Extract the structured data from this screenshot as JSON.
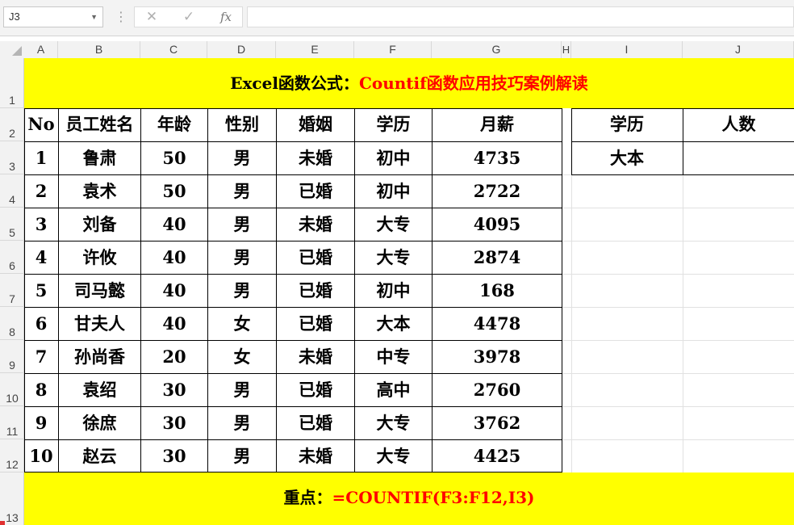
{
  "formula_bar": {
    "name_box": "J3",
    "cancel_icon": "✕",
    "enter_icon": "✓",
    "fx_label": "fx",
    "formula": ""
  },
  "columns": [
    "A",
    "B",
    "C",
    "D",
    "E",
    "F",
    "G",
    "H",
    "I",
    "J"
  ],
  "rows": [
    "1",
    "2",
    "3",
    "4",
    "5",
    "6",
    "7",
    "8",
    "9",
    "10",
    "11",
    "12",
    "13"
  ],
  "title": {
    "prefix": "Excel函数公式：",
    "highlight": "Countif函数应用技巧案例解读"
  },
  "table": {
    "headers": [
      "No",
      "员工姓名",
      "年龄",
      "性别",
      "婚姻",
      "学历",
      "月薪"
    ],
    "rows": [
      [
        "1",
        "鲁肃",
        "50",
        "男",
        "未婚",
        "初中",
        "4735"
      ],
      [
        "2",
        "袁术",
        "50",
        "男",
        "已婚",
        "初中",
        "2722"
      ],
      [
        "3",
        "刘备",
        "40",
        "男",
        "未婚",
        "大专",
        "4095"
      ],
      [
        "4",
        "许攸",
        "40",
        "男",
        "已婚",
        "大专",
        "2874"
      ],
      [
        "5",
        "司马懿",
        "40",
        "男",
        "已婚",
        "初中",
        "168"
      ],
      [
        "6",
        "甘夫人",
        "40",
        "女",
        "已婚",
        "大本",
        "4478"
      ],
      [
        "7",
        "孙尚香",
        "20",
        "女",
        "未婚",
        "中专",
        "3978"
      ],
      [
        "8",
        "袁绍",
        "30",
        "男",
        "已婚",
        "高中",
        "2760"
      ],
      [
        "9",
        "徐庶",
        "30",
        "男",
        "已婚",
        "大专",
        "3762"
      ],
      [
        "10",
        "赵云",
        "30",
        "男",
        "未婚",
        "大专",
        "4425"
      ]
    ]
  },
  "lookup": {
    "headers": [
      "学历",
      "人数"
    ],
    "criteria": "大本",
    "result": ""
  },
  "footer": {
    "prefix": "重点：",
    "formula": "=COUNTIF(F3:F12,I3)"
  }
}
